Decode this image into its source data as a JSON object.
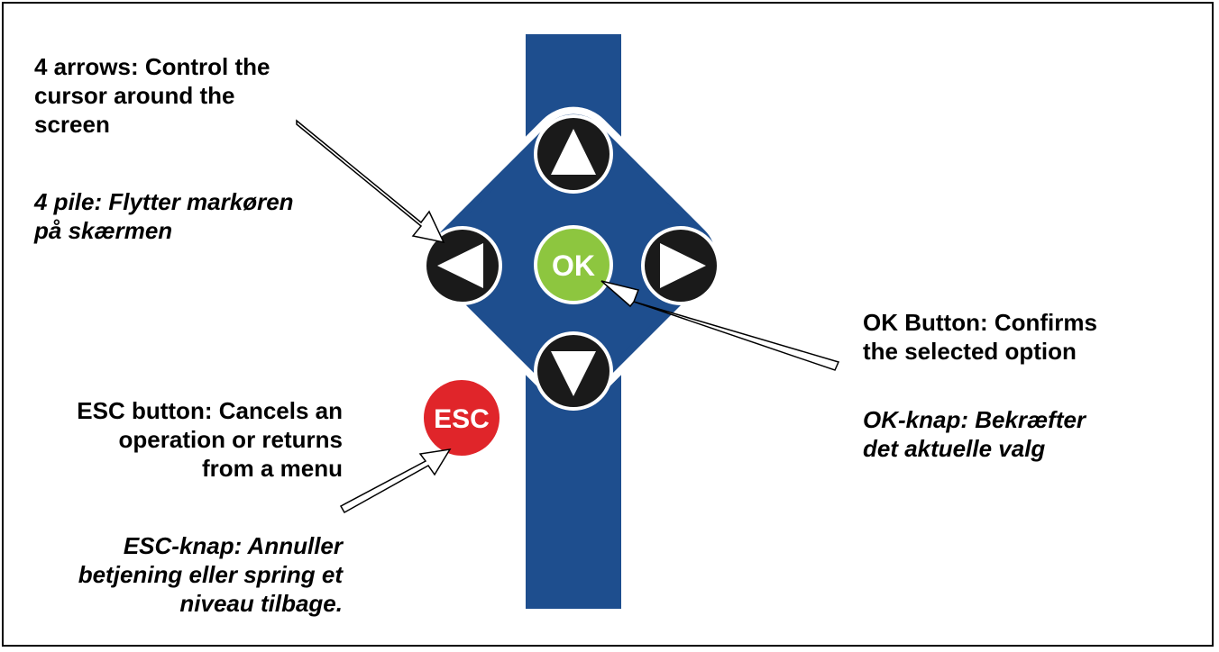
{
  "labels": {
    "arrows_en_1": "4 arrows: Control the",
    "arrows_en_2": "cursor around the",
    "arrows_en_3": "screen",
    "arrows_da_1": "4 pile: Flytter markøren",
    "arrows_da_2": "på skærmen",
    "ok_en_1": "OK Button: Confirms",
    "ok_en_2": "the selected option",
    "ok_da_1": "OK-knap: Bekræfter",
    "ok_da_2": "det aktuelle valg",
    "esc_en_1": "ESC button: Cancels an",
    "esc_en_2": "operation or returns",
    "esc_en_3": "from a menu",
    "esc_da_1": "ESC-knap: Annuller",
    "esc_da_2": "betjening eller spring et",
    "esc_da_3": "niveau tilbage."
  },
  "keypad": {
    "ok_label": "OK",
    "esc_label": "ESC",
    "icons": [
      "up-arrow-icon",
      "down-arrow-icon",
      "left-arrow-icon",
      "right-arrow-icon"
    ]
  },
  "colors": {
    "keypad_blue": "#1e4e8e",
    "ok_green": "#8dc63f",
    "esc_red": "#e0252a",
    "arrow_button": "#1a1a1a"
  }
}
